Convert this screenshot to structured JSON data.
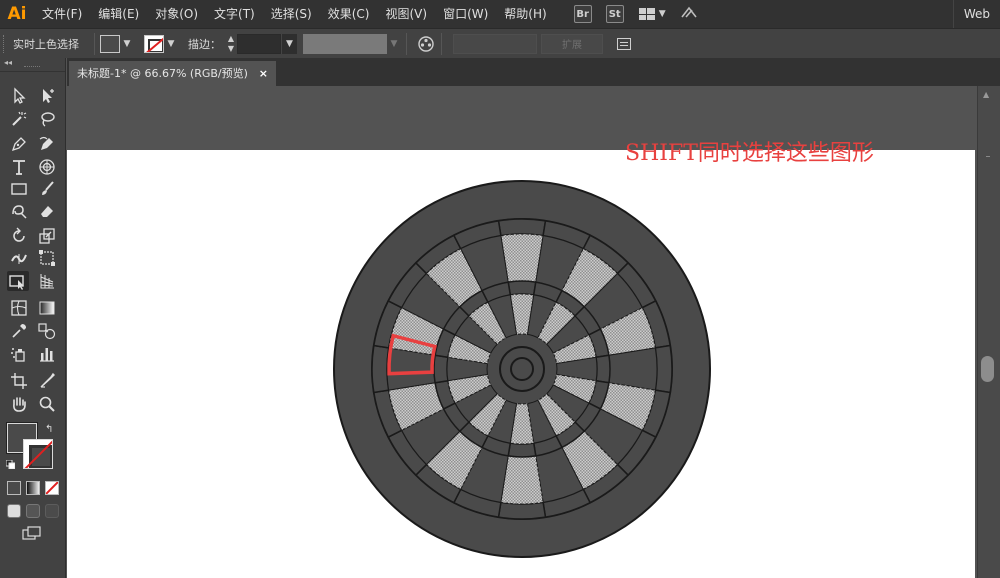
{
  "app": {
    "logo": "Ai",
    "workspace": "Web"
  },
  "menu": [
    {
      "label": "文件(F)"
    },
    {
      "label": "编辑(E)"
    },
    {
      "label": "对象(O)"
    },
    {
      "label": "文字(T)"
    },
    {
      "label": "选择(S)"
    },
    {
      "label": "效果(C)"
    },
    {
      "label": "视图(V)"
    },
    {
      "label": "窗口(W)"
    },
    {
      "label": "帮助(H)"
    }
  ],
  "menu_icons": {
    "bridge": "Br",
    "stock": "St"
  },
  "control_bar": {
    "tool_name": "实时上色选择",
    "stroke_label": "描边：",
    "stroke_weight": "",
    "expand_label": "扩展"
  },
  "document": {
    "tab_title": "未标题-1* @ 66.67% (RGB/预览)",
    "close_glyph": "×"
  },
  "annotation": {
    "text": "SHIFT同时选择这些图形",
    "color": "#e8413f"
  },
  "colors": {
    "accent_logo": "#ff9a00",
    "fill": "#4a4a4a",
    "selection_outline": "#e84040"
  }
}
